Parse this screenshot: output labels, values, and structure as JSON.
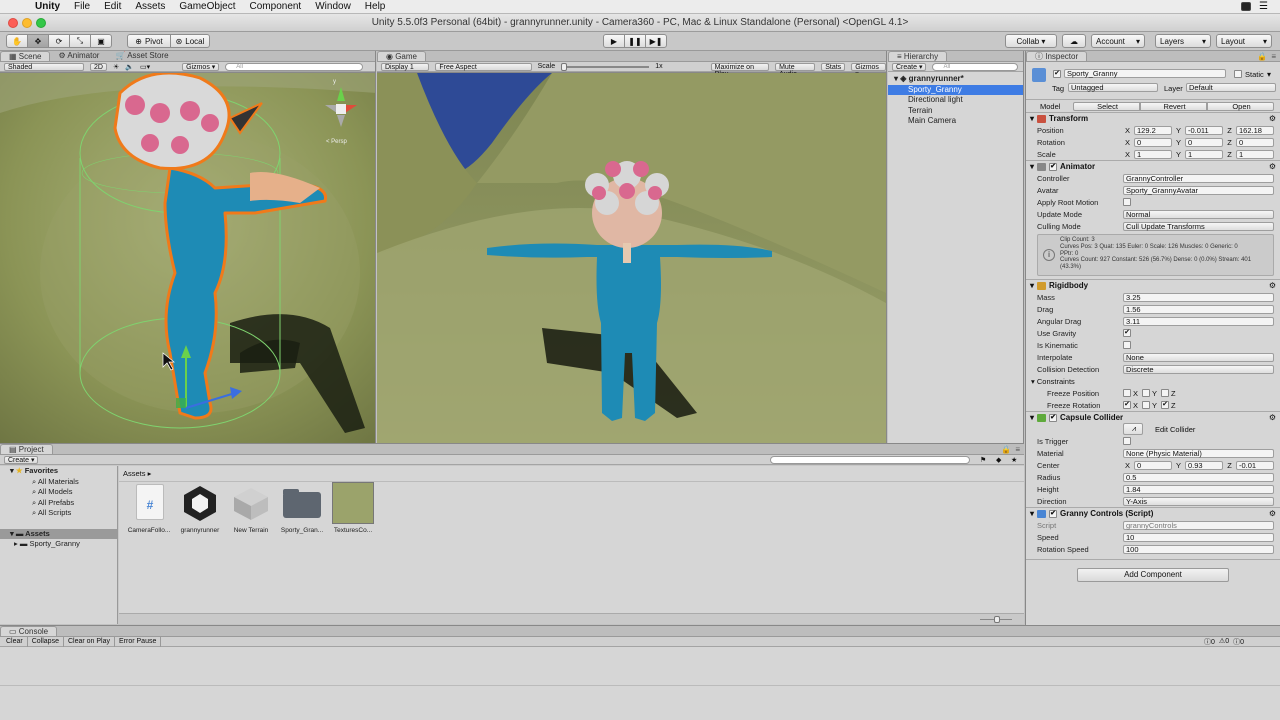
{
  "menubar": {
    "items": [
      "Unity",
      "File",
      "Edit",
      "Assets",
      "GameObject",
      "Component",
      "Window",
      "Help"
    ]
  },
  "window": {
    "title": "Unity 5.5.0f3 Personal (64bit) - grannyrunner.unity - Camera360 - PC, Mac & Linux Standalone (Personal) <OpenGL 4.1>"
  },
  "toolbar": {
    "pivot": "Pivot",
    "local": "Local",
    "collab": "Collab ▾",
    "account": "Account",
    "layers": "Layers",
    "layout": "Layout"
  },
  "scene": {
    "tabs": [
      "Scene",
      "Animator",
      "Asset Store"
    ],
    "shading": "Shaded",
    "mode2d": "2D",
    "gizmos": "Gizmos ▾",
    "search_placeholder": "All",
    "gizmo_label": "< Persp"
  },
  "game": {
    "tab": "Game",
    "display": "Display 1",
    "aspect": "Free Aspect",
    "scale_label": "Scale",
    "scale_value": "1x",
    "maximize": "Maximize on Play",
    "mute": "Mute Audio",
    "stats": "Stats",
    "gizmos": "Gizmos ▾"
  },
  "hierarchy": {
    "tab": "Hierarchy",
    "create": "Create ▾",
    "search_placeholder": "All",
    "scene_name": "grannyrunner*",
    "items": [
      "Sporty_Granny",
      "Directional light",
      "Terrain",
      "Main Camera"
    ]
  },
  "inspector": {
    "tab": "Inspector",
    "object_name": "Sporty_Granny",
    "static_label": "Static",
    "tag_label": "Tag",
    "tag_value": "Untagged",
    "layer_label": "Layer",
    "layer_value": "Default",
    "model_label": "Model",
    "model_select": "Select",
    "model_revert": "Revert",
    "model_open": "Open",
    "transform": {
      "title": "Transform",
      "position_label": "Position",
      "pos_x": "129.2",
      "pos_y": "-0.011",
      "pos_z": "162.18",
      "rotation_label": "Rotation",
      "rot_x": "0",
      "rot_y": "0",
      "rot_z": "0",
      "scale_label": "Scale",
      "scale_x": "1",
      "scale_y": "1",
      "scale_z": "1"
    },
    "animator": {
      "title": "Animator",
      "controller_label": "Controller",
      "controller_value": "GrannyController",
      "avatar_label": "Avatar",
      "avatar_value": "Sporty_GrannyAvatar",
      "root_motion_label": "Apply Root Motion",
      "update_mode_label": "Update Mode",
      "update_mode_value": "Normal",
      "culling_label": "Culling Mode",
      "culling_value": "Cull Update Transforms",
      "info_line1": "Clip Count: 3",
      "info_line2": "Curves Pos: 3 Quat: 135 Euler: 0 Scale: 126 Muscles: 0 Generic: 0",
      "info_line3": "PPtr: 0",
      "info_line4": "Curves Count: 927 Constant: 526 (56.7%) Dense: 0 (0.0%) Stream: 401",
      "info_line5": "(43.3%)"
    },
    "rigidbody": {
      "title": "Rigidbody",
      "mass_label": "Mass",
      "mass": "3.25",
      "drag_label": "Drag",
      "drag": "1.56",
      "angular_label": "Angular Drag",
      "angular": "3.11",
      "gravity_label": "Use Gravity",
      "kinematic_label": "Is Kinematic",
      "interpolate_label": "Interpolate",
      "interpolate": "None",
      "collision_label": "Collision Detection",
      "collision": "Discrete",
      "constraints_label": "Constraints",
      "freeze_pos_label": "Freeze Position",
      "freeze_rot_label": "Freeze Rotation"
    },
    "capsule": {
      "title": "Capsule Collider",
      "edit_label": "Edit Collider",
      "trigger_label": "Is Trigger",
      "material_label": "Material",
      "material": "None (Physic Material)",
      "center_label": "Center",
      "cx": "0",
      "cy": "0.93",
      "cz": "-0.01",
      "radius_label": "Radius",
      "radius": "0.5",
      "height_label": "Height",
      "height": "1.84",
      "direction_label": "Direction",
      "direction": "Y-Axis"
    },
    "script": {
      "title": "Granny Controls (Script)",
      "script_label": "Script",
      "script_value": "grannyControls",
      "speed_label": "Speed",
      "speed": "10",
      "rot_speed_label": "Rotation Speed",
      "rot_speed": "100"
    },
    "add_component": "Add Component"
  },
  "project": {
    "tab": "Project",
    "create": "Create ▾",
    "favorites": "Favorites",
    "fav_items": [
      "All Materials",
      "All Models",
      "All Prefabs",
      "All Scripts"
    ],
    "assets_root": "Assets",
    "asset_children": [
      "Sporty_Granny"
    ],
    "breadcrumb": "Assets ▸",
    "assets": [
      "CameraFollo...",
      "grannyrunner",
      "New Terrain",
      "Sporty_Gran...",
      "TexturesCo..."
    ]
  },
  "console": {
    "tab": "Console",
    "buttons": [
      "Clear",
      "Collapse",
      "Clear on Play",
      "Error Pause"
    ],
    "count_info": "0",
    "count_warn": "0",
    "count_error": "0"
  },
  "colors": {
    "selection": "#3e7ce4",
    "granny_suit": "#1e8bb5",
    "hair_pink": "#d9688f",
    "selection_outline": "#f07a1a",
    "grass": "#8c9654",
    "sky": "#2e4a96"
  }
}
